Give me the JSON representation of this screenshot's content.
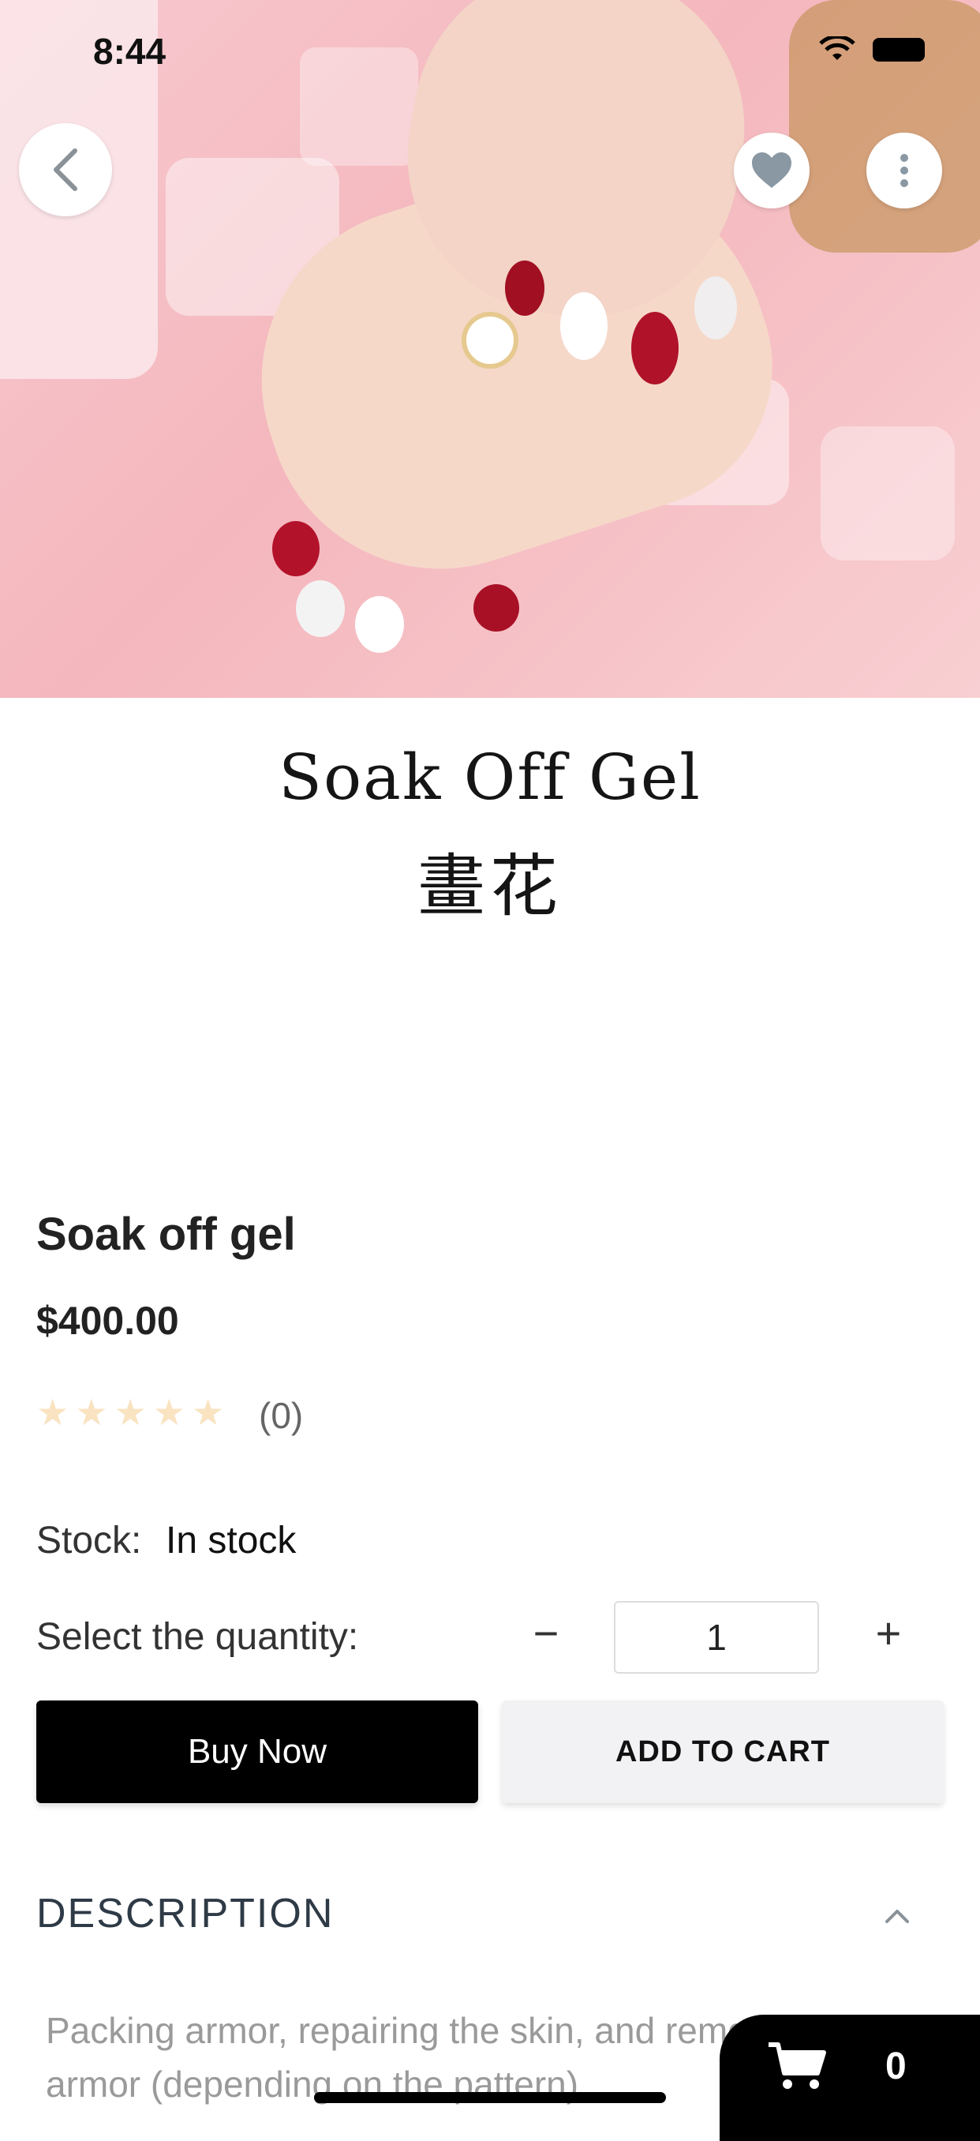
{
  "status_bar": {
    "time": "8:44"
  },
  "hero": {
    "image_desc": ""
  },
  "brand": {
    "name_en": "Soak Off Gel",
    "name_zh": "畫花"
  },
  "product": {
    "title": "Soak off gel",
    "price": "$400.00",
    "rating": 0,
    "rating_max": 5,
    "review_count": "(0)",
    "stock_label": "Stock:",
    "stock_value": "In stock"
  },
  "quantity": {
    "label": "Select the quantity:",
    "minus": "−",
    "value": "1",
    "plus": "+"
  },
  "actions": {
    "buy_now": "Buy Now",
    "add_to_cart": "ADD TO CART"
  },
  "description": {
    "heading": "DESCRIPTION",
    "text": "Packing armor, repairing the skin, and removing the armor (depending on the pattern)"
  },
  "cart": {
    "count": "0"
  },
  "colors": {
    "accent": "#000000",
    "star_empty": "#f9e3c1",
    "heading": "#2e3a46"
  }
}
